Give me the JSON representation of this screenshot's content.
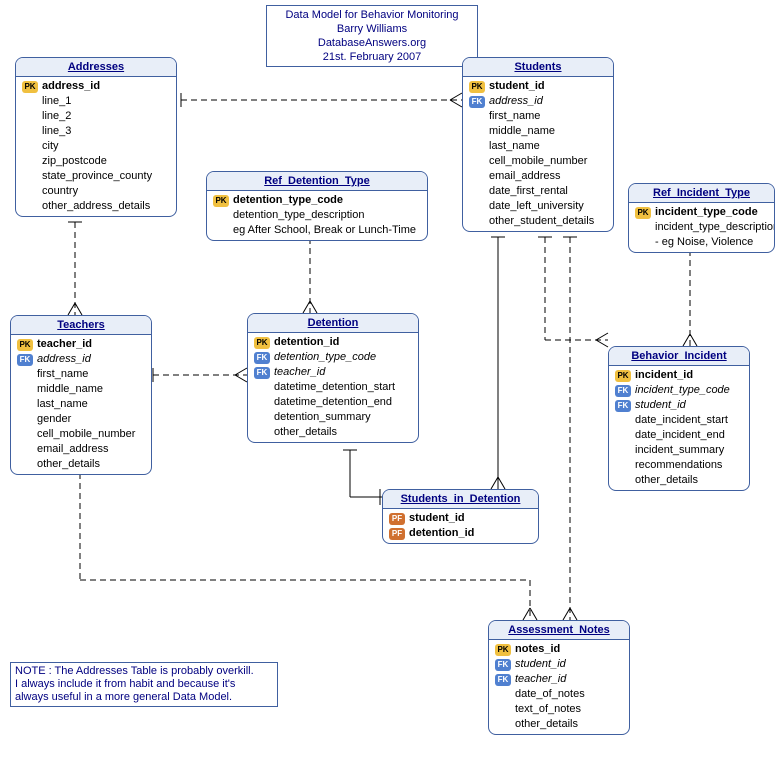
{
  "title": {
    "line1": "Data Model for Behavior Monitoring",
    "line2": "Barry Williams",
    "line3": "DatabaseAnswers.org",
    "line4": "21st. February 2007"
  },
  "note": {
    "line1": "NOTE : The Addresses Table is probably overkill.",
    "line2": "I always include it from habit and because it's",
    "line3": "always useful in a more general Data Model."
  },
  "entities": {
    "addresses": {
      "name": "Addresses",
      "fields": {
        "address_id": "address_id",
        "line_1": "line_1",
        "line_2": "line_2",
        "line_3": "line_3",
        "city": "city",
        "zip_postcode": "zip_postcode",
        "state_province_county": "state_province_county",
        "country": "country",
        "other_address_details": "other_address_details"
      }
    },
    "students": {
      "name": "Students",
      "fields": {
        "student_id": "student_id",
        "address_id": "address_id",
        "first_name": "first_name",
        "middle_name": "middle_name",
        "last_name": "last_name",
        "cell_mobile_number": "cell_mobile_number",
        "email_address": "email_address",
        "date_first_rental": "date_first_rental",
        "date_left_university": "date_left_university",
        "other_student_details": "other_student_details"
      }
    },
    "ref_detention_type": {
      "name": "Ref_Detention_Type",
      "fields": {
        "detention_type_code": "detention_type_code",
        "detention_type_description": "detention_type_description",
        "eg": "eg After School, Break or Lunch-Time"
      }
    },
    "ref_incident_type": {
      "name": "Ref_Incident_Type",
      "fields": {
        "incident_type_code": "incident_type_code",
        "incident_type_description": "incident_type_description",
        "eg": "- eg Noise, Violence"
      }
    },
    "teachers": {
      "name": "Teachers",
      "fields": {
        "teacher_id": "teacher_id",
        "address_id": "address_id",
        "first_name": "first_name",
        "middle_name": "middle_name",
        "last_name": "last_name",
        "gender": "gender",
        "cell_mobile_number": "cell_mobile_number",
        "email_address": "email_address",
        "other_details": "other_details"
      }
    },
    "detention": {
      "name": "Detention",
      "fields": {
        "detention_id": "detention_id",
        "detention_type_code": "detention_type_code",
        "teacher_id": "teacher_id",
        "datetime_detention_start": "datetime_detention_start",
        "datetime_detention_end": "datetime_detention_end",
        "detention_summary": "detention_summary",
        "other_details": "other_details"
      }
    },
    "behavior_incident": {
      "name": "Behavior_Incident",
      "fields": {
        "incident_id": "incident_id",
        "incident_type_code": "incident_type_code",
        "student_id": "student_id",
        "date_incident_start": "date_incident_start",
        "date_incident_end": "date_incident_end",
        "incident_summary": "incident_summary",
        "recommendations": "recommendations",
        "other_details": "other_details"
      }
    },
    "students_in_detention": {
      "name": "Students_in_Detention",
      "fields": {
        "student_id": "student_id",
        "detention_id": "detention_id"
      }
    },
    "assessment_notes": {
      "name": "Assessment_Notes",
      "fields": {
        "notes_id": "notes_id",
        "student_id": "student_id",
        "teacher_id": "teacher_id",
        "date_of_notes": "date_of_notes",
        "text_of_notes": "text_of_notes",
        "other_details": "other_details"
      }
    }
  }
}
